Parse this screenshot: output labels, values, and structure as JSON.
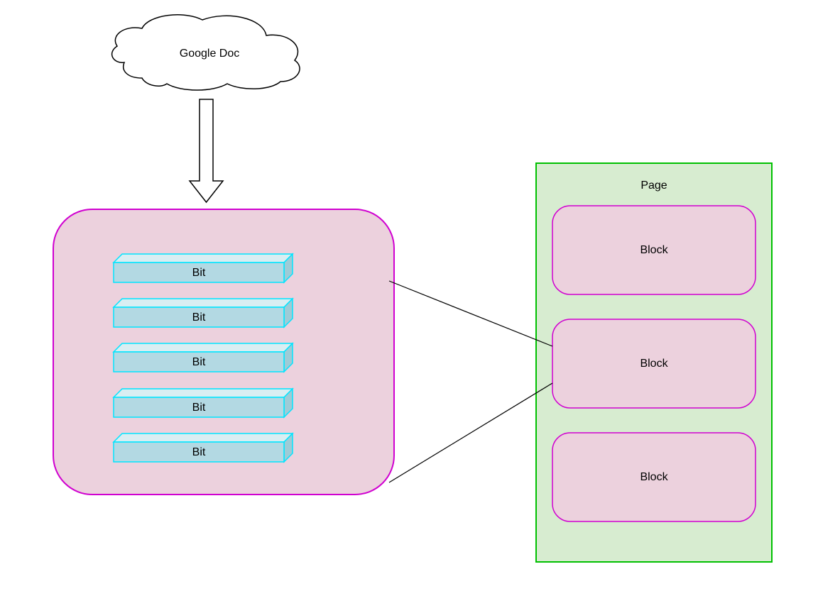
{
  "cloud": {
    "label": "Google Doc"
  },
  "bits_panel": {
    "items": [
      "Bit",
      "Bit",
      "Bit",
      "Bit",
      "Bit"
    ]
  },
  "page_panel": {
    "title": "Page",
    "blocks": [
      "Block",
      "Block",
      "Block"
    ]
  },
  "colors": {
    "cloud_stroke": "#000000",
    "cloud_fill": "#ffffff",
    "arrow_stroke": "#000000",
    "arrow_fill": "#ffffff",
    "bits_panel_fill": "#ecd1dd",
    "bits_panel_stroke": "#d000d0",
    "bit_front_fill": "#b3d9e3",
    "bit_side_fill": "#9ecbd6",
    "bit_top_fill": "#d9eef2",
    "bit_stroke": "#00e5ff",
    "page_panel_fill": "#d7ecd0",
    "page_panel_stroke": "#00c000",
    "block_fill": "#ecd1dd",
    "block_stroke": "#d000d0",
    "connector": "#000000"
  }
}
